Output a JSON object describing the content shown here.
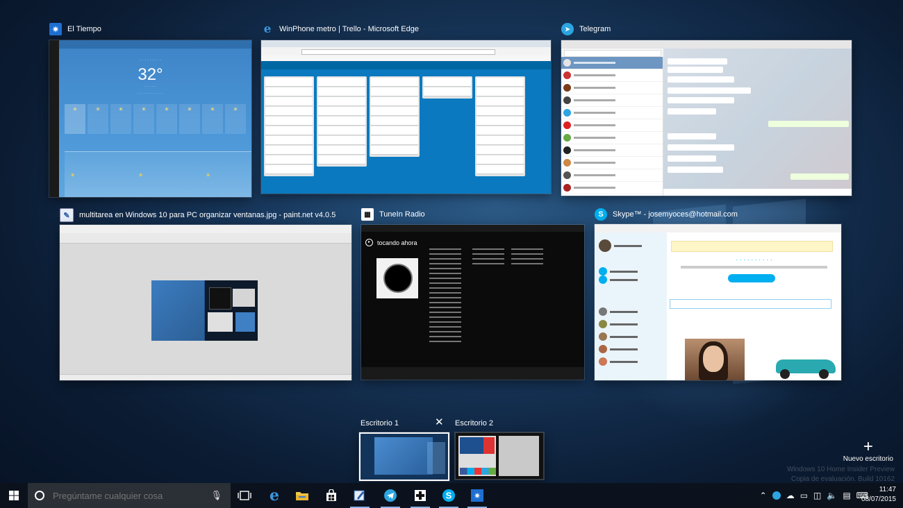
{
  "windows": [
    {
      "title": "El Tiempo",
      "temp": "32°"
    },
    {
      "title": "WinPhone metro | Trello - Microsoft Edge"
    },
    {
      "title": "Telegram"
    },
    {
      "title": "multitarea en Windows 10 para PC organizar ventanas.jpg - paint.net v4.0.5"
    },
    {
      "title": "TuneIn Radio",
      "now_playing": "tocando ahora"
    },
    {
      "title": "Skype™ - josemyoces@hotmail.com"
    }
  ],
  "desktops": [
    {
      "label": "Escritorio 1"
    },
    {
      "label": "Escritorio 2"
    }
  ],
  "new_desktop": {
    "label": "Nuevo escritorio",
    "icon": "+"
  },
  "watermark": [
    "Windows 10 Home Insider Preview",
    "Copia de evaluación. Build 10162"
  ],
  "taskbar": {
    "search_placeholder": "Pregúntame cualquier cosa",
    "apps": [
      "task-view",
      "edge",
      "file-explorer",
      "store",
      "paint-net",
      "telegram",
      "tunein",
      "skype",
      "weather"
    ]
  },
  "clock": {
    "time": "11:47",
    "date": "08/07/2015"
  }
}
